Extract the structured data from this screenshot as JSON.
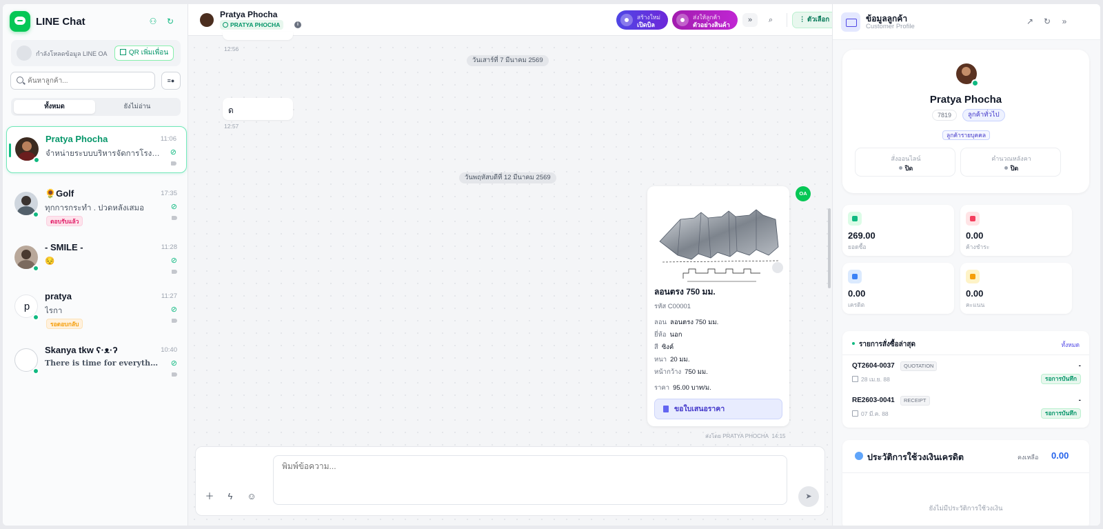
{
  "sidebar": {
    "app_title": "LINE Chat",
    "oa_status": "กำลังโหลดข้อมูล LINE OA",
    "qr_button": "QR เพิ่มเพื่อน",
    "search_placeholder": "ค้นหาลูกค้า...",
    "filter_label": "≡●",
    "tabs": [
      {
        "label": "ทั้งหมด",
        "active": true
      },
      {
        "label": "ยังไม่อ่าน",
        "active": false
      }
    ],
    "chats": [
      {
        "name": "Pratya Phocha",
        "time": "11:06",
        "preview": "จำหน่ายระบบบริหารจัดการโรงงาน",
        "badge": ""
      },
      {
        "name": "🌻Golf",
        "time": "17:35",
        "preview": "ทุกการกระทำ . ปวดหลังเสมอ",
        "badge": "ตอบรับแล้ว"
      },
      {
        "name": "- SMILE -",
        "time": "11:28",
        "preview": "😔",
        "badge": ""
      },
      {
        "name": "pratya",
        "time": "11:27",
        "preview": "ไรกา",
        "badge": "รอตอบกลับ",
        "initial": "p"
      },
      {
        "name": "Skanya tkw ʕ·ᴥ·ʔ",
        "time": "10:40",
        "preview": "There is time for everything . . .",
        "badge": ""
      }
    ]
  },
  "chat": {
    "name": "Pratya Phocha",
    "sub_label": "PRATYA PHOCHA",
    "info": "i",
    "btn_bill": {
      "line1": "สร้างใหม่",
      "line2": "เปิดบิล"
    },
    "btn_sample": {
      "line1": "ส่งให้ลูกค้า",
      "line2": "ตัวอย่างสินค้า"
    },
    "options_label": "⋮ ตัวเลือก",
    "messages": {
      "time_top": "12:56",
      "date1": "วันเสาร์ที่ 7 มีนาคม 2569",
      "text1": "ด",
      "time1": "12:57",
      "date2": "วันพฤหัสบดีที่ 12 มีนาคม 2569"
    },
    "product_card": {
      "title": "ลอนตรง 750 มม.",
      "code": "รหัส C00001",
      "specs": [
        {
          "key": "ลอน",
          "value": "ลอนตรง 750 มม."
        },
        {
          "key": "ยี่ห้อ",
          "value": "นอก"
        },
        {
          "key": "สี",
          "value": "ซิงค์"
        },
        {
          "key": "หนา",
          "value": "20 มม."
        },
        {
          "key": "หน้ากว้าง",
          "value": "750 มม."
        }
      ],
      "price_key": "ราคา",
      "price": "95.00 บาท/ม.",
      "quote_button": "ขอใบเสนอราคา",
      "oa_badge": "OA",
      "sent_by": "ส่งโดย PRATYA PHOCHA",
      "sent_time": "14:15"
    },
    "composer_placeholder": "พิมพ์ข้อความ..."
  },
  "profile": {
    "header_title": "ข้อมูลลูกค้า",
    "header_sub": "Customer Profile",
    "name": "Pratya Phocha",
    "customer_id": "7819",
    "customer_type": "ลูกค้าทั่วไป",
    "category": "ลูกค้ารายบุคคล",
    "toggles": [
      {
        "label": "สั่งออนไลน์",
        "value": "ปิด"
      },
      {
        "label": "คำนวณหลังคา",
        "value": "ปิด"
      }
    ],
    "stats": [
      {
        "value": "269.00",
        "label": "ยอดซื้อ",
        "color": "#10b981",
        "bg": "#dcfce7"
      },
      {
        "value": "0.00",
        "label": "ค้างชำระ",
        "color": "#f43f5e",
        "bg": "#ffe4e6"
      },
      {
        "value": "0.00",
        "label": "เครดิต",
        "color": "#3b82f6",
        "bg": "#dbeafe"
      },
      {
        "value": "0.00",
        "label": "คะแนน",
        "color": "#f59e0b",
        "bg": "#fef3c7"
      }
    ],
    "orders": {
      "title": "รายการสั่งซื้อล่าสุด",
      "view_all": "ทั้งหมด",
      "items": [
        {
          "no": "QT2604-0037",
          "type": "QUOTATION",
          "date": "28 เม.ย. 88",
          "amount": "-",
          "status": "รอการบันทึก"
        },
        {
          "no": "RE2603-0041",
          "type": "RECEIPT",
          "date": "07 มี.ค. 88",
          "amount": "-",
          "status": "รอการบันทึก"
        }
      ]
    },
    "credit": {
      "title": "ประวัติการใช้วงเงินเครดิต",
      "remaining_label": "คงเหลือ",
      "remaining_value": "0.00",
      "empty_text": "ยังไม่มีประวัติการใช้วงเงิน"
    }
  }
}
